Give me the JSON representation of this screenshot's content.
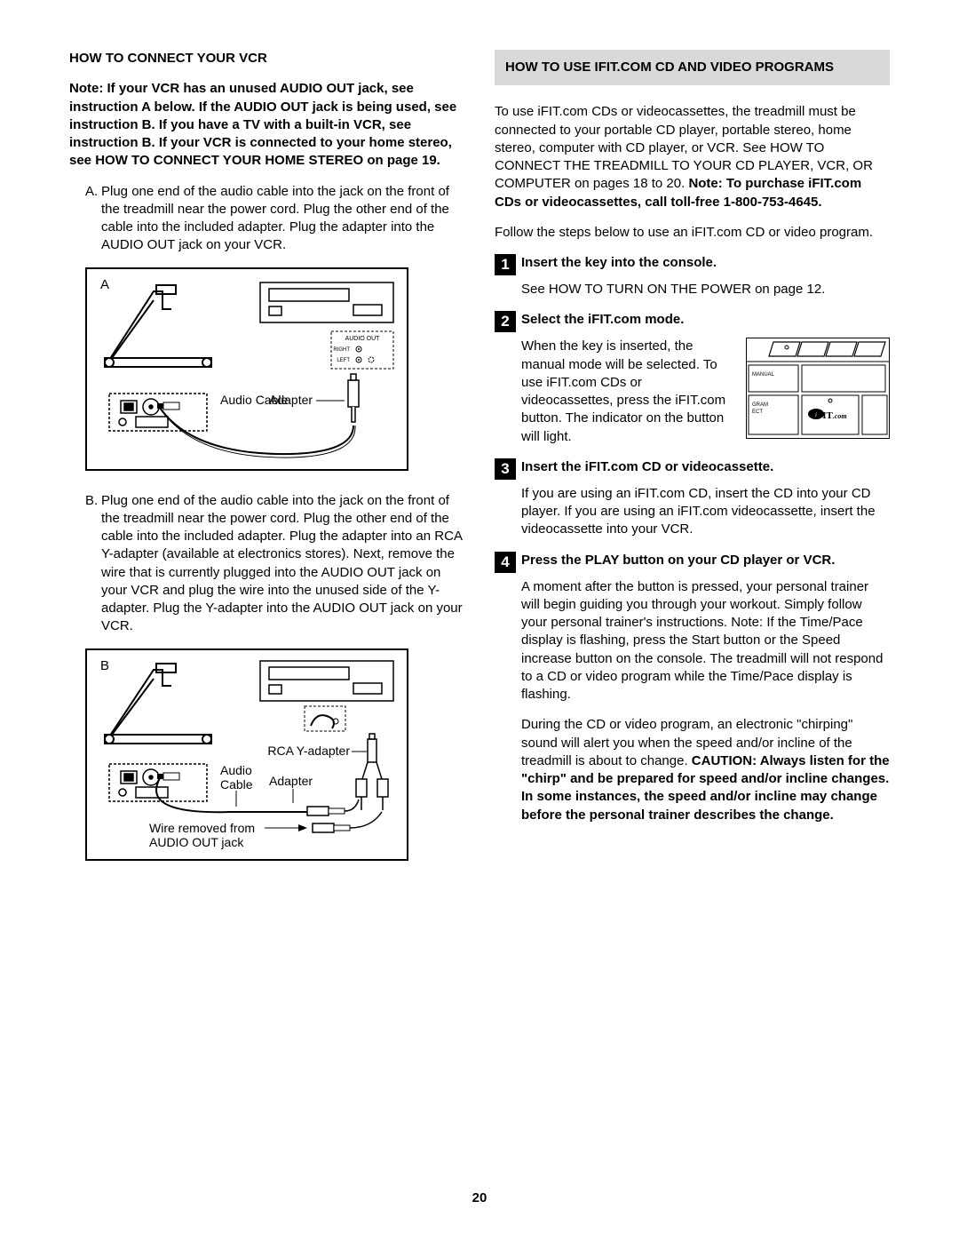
{
  "left": {
    "title": "HOW TO CONNECT YOUR VCR",
    "note": "Note: If your VCR has an unused AUDIO OUT jack, see instruction A below. If the AUDIO OUT jack is being used, see instruction B. If you have a TV with a built-in VCR, see instruction B. If your VCR is connected to your home stereo, see HOW TO CONNECT YOUR HOME STEREO on page 19.",
    "itemA": {
      "label": "A.",
      "text": "Plug one end of the audio cable into the jack on the front of the treadmill near the power cord. Plug the other end of the cable into the included adapter. Plug the adapter into the AUDIO OUT jack on your VCR.",
      "diag": {
        "label": "A",
        "audio_cable": "Audio Cable",
        "adapter": "Adapter",
        "audio_out": "AUDIO OUT",
        "right": "RIGHT",
        "left": "LEFT"
      }
    },
    "itemB": {
      "label": "B.",
      "text": "Plug one end of the audio cable into the jack on the front of the treadmill near the power cord. Plug the other end of the cable into the included adapter. Plug the adapter into an RCA Y-adapter (available at electronics stores). Next, remove the wire that is currently plugged into the AUDIO OUT jack on your VCR and plug the wire into the unused side of the Y-adapter. Plug the Y-adapter into the AUDIO OUT jack on your VCR.",
      "diag": {
        "label": "B",
        "rca": "RCA Y-adapter",
        "audio_cable": "Audio Cable",
        "adapter": "Adapter",
        "wire": "Wire removed from AUDIO OUT jack"
      }
    }
  },
  "right": {
    "title": "HOW TO USE IFIT.COM CD AND VIDEO PROGRAMS",
    "intro1a": "To use iFIT.com CDs or videocassettes, the treadmill must be connected to your portable CD player, portable stereo, home stereo, computer with CD player, or VCR. See HOW TO CONNECT THE TREADMILL TO YOUR CD PLAYER, VCR, OR COMPUTER on pages 18 to 20. ",
    "intro1b": "Note: To purchase iFIT.com CDs or videocassettes, call toll-free 1-800-753-4645.",
    "intro2": "Follow the steps below to use an iFIT.com CD or video program.",
    "steps": {
      "s1": {
        "num": "1",
        "title": "Insert the key into the console.",
        "body": "See HOW TO TURN ON THE POWER on page 12."
      },
      "s2": {
        "num": "2",
        "title": "Select the iFIT.com mode.",
        "body": "When the key is inserted, the manual mode will be selected. To use iFIT.com CDs or videocassettes, press the iFIT.com button. The indicator on the button will light.",
        "console": {
          "manual": "MANUAL",
          "program": "PROGRAM\nSELECT",
          "ifit": "iFIT.com"
        }
      },
      "s3": {
        "num": "3",
        "title": "Insert the iFIT.com CD or videocassette.",
        "body": "If you are using an iFIT.com CD, insert the CD into your CD player. If you are using an iFIT.com videocassette, insert the videocassette into your VCR."
      },
      "s4": {
        "num": "4",
        "title": "Press the PLAY button on your CD player or VCR.",
        "body1": "A moment after the button is pressed, your personal trainer will begin guiding you through your workout. Simply follow your personal trainer's instructions. Note: If the Time/Pace display is flashing, press the Start button or the Speed increase button on the console. The treadmill will not respond to a CD or video program while the Time/Pace display is flashing.",
        "body2a": "During the CD or video program, an electronic \"chirping\" sound will alert you when the speed and/or incline of the treadmill is about to change. ",
        "body2b": "CAUTION: Always listen for the \"chirp\" and be prepared for speed and/or incline changes. In some instances, the speed and/or incline may change before the personal trainer describes the change."
      }
    }
  },
  "pagenum": "20"
}
